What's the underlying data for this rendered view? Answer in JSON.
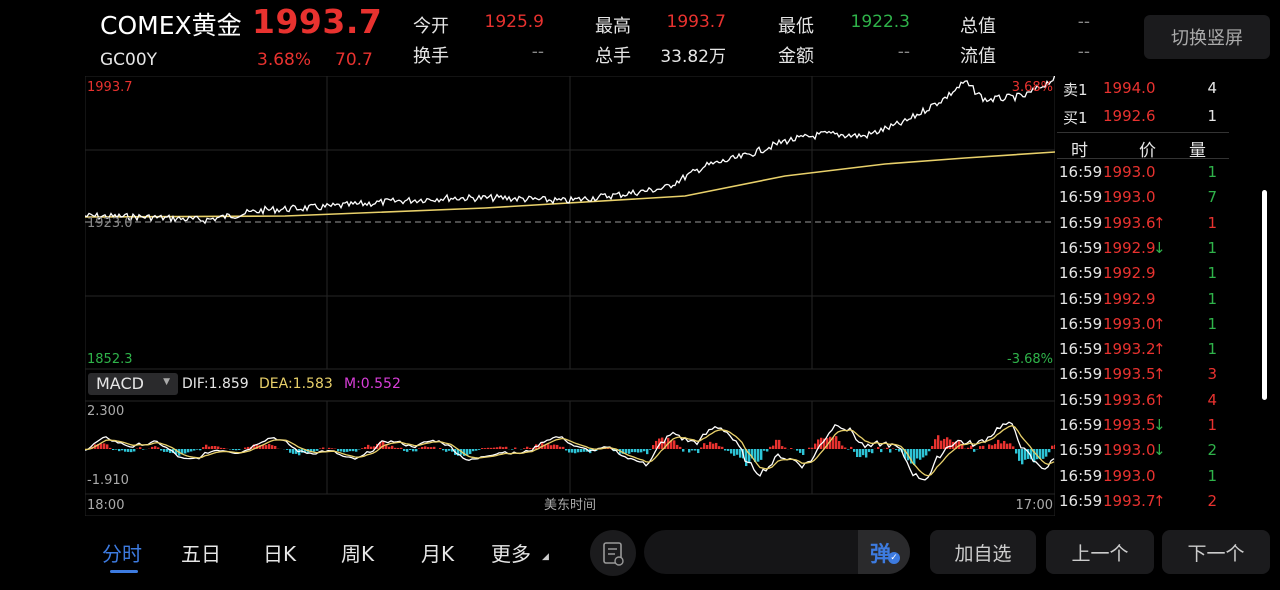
{
  "header": {
    "title": "COMEX黄金",
    "price": "1993.7",
    "code": "GC00Y",
    "change_pct": "3.68%",
    "change": "70.7",
    "stats": [
      {
        "label": "今开",
        "value": "1925.9",
        "color": "red"
      },
      {
        "label": "最高",
        "value": "1993.7",
        "color": "red"
      },
      {
        "label": "最低",
        "value": "1922.3",
        "color": "green"
      },
      {
        "label": "总值",
        "value": "--",
        "color": "dim"
      },
      {
        "label": "换手",
        "value": "--",
        "color": "dim"
      },
      {
        "label": "总手",
        "value": "33.82万",
        "color": "white"
      },
      {
        "label": "金额",
        "value": "--",
        "color": "dim"
      },
      {
        "label": "流值",
        "value": "--",
        "color": "dim"
      }
    ],
    "switch_label": "切换竖屏"
  },
  "chart": {
    "y_max_label": "1993.7",
    "y_min_label": "1852.3",
    "y_mid_label": "1923.0",
    "pct_max_label": "3.68%",
    "pct_min_label": "-3.68%",
    "x_start_label": "18:00",
    "x_mid_label": "美东时间",
    "x_end_label": "17:00",
    "colors": {
      "up": "#e8322f",
      "down": "#2fb34a",
      "price_line": "#ffffff",
      "avg_line": "#e8d06a",
      "macd_pos": "#e8322f",
      "macd_neg": "#2ec4d6"
    }
  },
  "macd": {
    "selector": "MACD",
    "dif": "DIF:1.859",
    "dea": "DEA:1.583",
    "m": "M:0.552",
    "y_max": "2.300",
    "y_min": "-1.910"
  },
  "orderbook": {
    "sell": {
      "label": "卖1",
      "price": "1994.0",
      "qty": "4"
    },
    "buy": {
      "label": "买1",
      "price": "1992.6",
      "qty": "1"
    },
    "headers": [
      "时",
      "价",
      "量"
    ],
    "ticks": [
      {
        "time": "16:59",
        "price": "1993.0",
        "arrow": "",
        "qty": "1",
        "qty_color": "green"
      },
      {
        "time": "16:59",
        "price": "1993.0",
        "arrow": "",
        "qty": "7",
        "qty_color": "green"
      },
      {
        "time": "16:59",
        "price": "1993.6",
        "arrow": "↑",
        "qty": "1",
        "qty_color": "red"
      },
      {
        "time": "16:59",
        "price": "1992.9",
        "arrow": "↓",
        "qty": "1",
        "qty_color": "green"
      },
      {
        "time": "16:59",
        "price": "1992.9",
        "arrow": "",
        "qty": "1",
        "qty_color": "green"
      },
      {
        "time": "16:59",
        "price": "1992.9",
        "arrow": "",
        "qty": "1",
        "qty_color": "green"
      },
      {
        "time": "16:59",
        "price": "1993.0",
        "arrow": "↑",
        "qty": "1",
        "qty_color": "green"
      },
      {
        "time": "16:59",
        "price": "1993.2",
        "arrow": "↑",
        "qty": "1",
        "qty_color": "green"
      },
      {
        "time": "16:59",
        "price": "1993.5",
        "arrow": "↑",
        "qty": "3",
        "qty_color": "red"
      },
      {
        "time": "16:59",
        "price": "1993.6",
        "arrow": "↑",
        "qty": "4",
        "qty_color": "red"
      },
      {
        "time": "16:59",
        "price": "1993.5",
        "arrow": "↓",
        "qty": "1",
        "qty_color": "red"
      },
      {
        "time": "16:59",
        "price": "1993.0",
        "arrow": "↓",
        "qty": "2",
        "qty_color": "green"
      },
      {
        "time": "16:59",
        "price": "1993.0",
        "arrow": "",
        "qty": "1",
        "qty_color": "green"
      },
      {
        "time": "16:59",
        "price": "1993.7",
        "arrow": "↑",
        "qty": "2",
        "qty_color": "red"
      }
    ]
  },
  "bottom": {
    "tabs": [
      "分时",
      "五日",
      "日K",
      "周K",
      "月K",
      "更多"
    ],
    "active_tab": "分时",
    "danmu_icon": "弹",
    "add_watch": "加自选",
    "prev": "上一个",
    "next": "下一个"
  }
}
